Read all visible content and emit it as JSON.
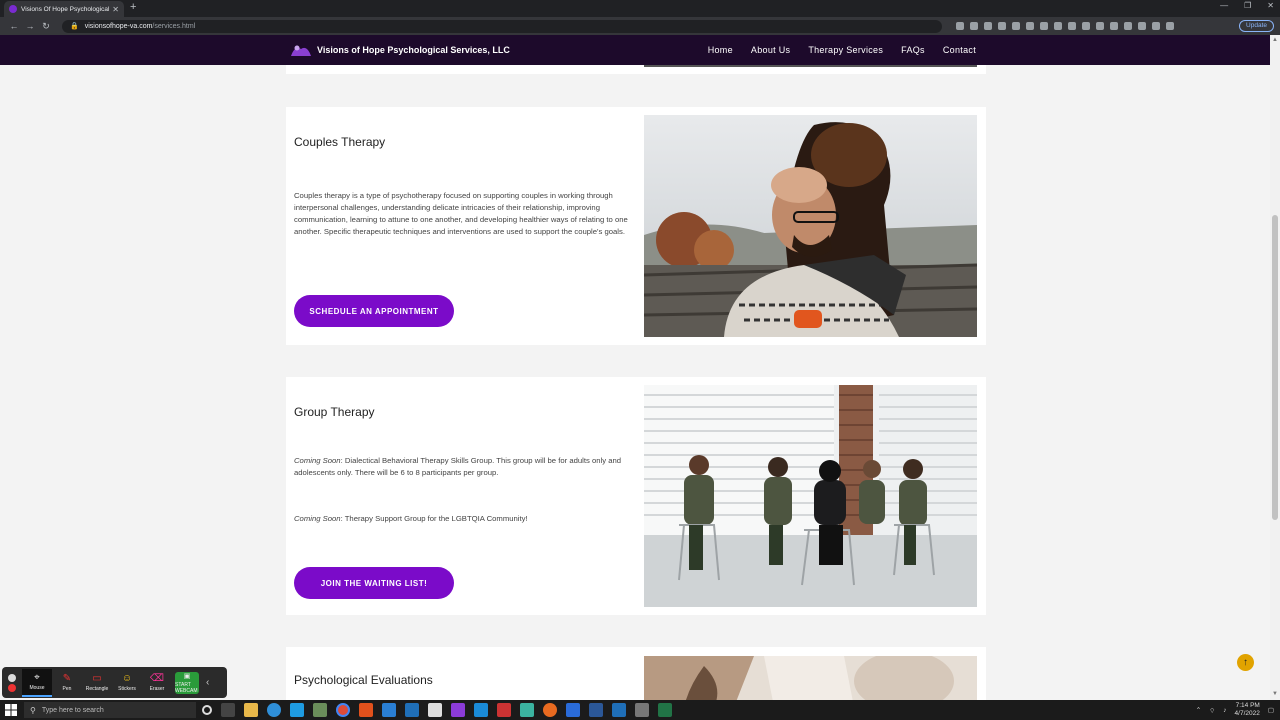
{
  "browser": {
    "tab_title": "Visions Of Hope Psychological S",
    "url_host": "visionsofhope-va.com",
    "url_path": "/services.html",
    "update_label": "Update"
  },
  "site": {
    "brand": "Visions of Hope Psychological Services, LLC",
    "nav": [
      "Home",
      "About Us",
      "Therapy Services",
      "FAQs",
      "Contact"
    ]
  },
  "sections": {
    "couples": {
      "title": "Couples Therapy",
      "body": "Couples therapy is a type of psychotherapy focused on supporting couples in working through interpersonal challenges, understanding delicate intricacies of their relationship, improving communication, learning to attune to one another, and developing healthier ways of relating to one another. Specific therapeutic techniques and interventions are used to support the couple's goals.",
      "button": "SCHEDULE AN APPOINTMENT"
    },
    "group": {
      "title": "Group Therapy",
      "item1_prefix": "Coming Soon",
      "item1_text": ": Dialectical Behavioral Therapy Skills Group. This group will be for adults only and adolescents only. There will be 6 to 8 participants per group.",
      "item2_prefix": "Coming Soon",
      "item2_text": ": Therapy Support Group for the LGBTQIA Community!",
      "button": "JOIN THE WAITING LIST!"
    },
    "evaluations": {
      "title": "Psychological Evaluations"
    }
  },
  "annotation_toolbar": {
    "tools": [
      "Mouse",
      "Pen",
      "Rectangle",
      "Stickers",
      "Eraser"
    ],
    "start": "START WEBCAM"
  },
  "taskbar": {
    "search_placeholder": "Type here to search",
    "time": "7:14 PM",
    "date": "4/7/2022"
  },
  "colors": {
    "nav_bg": "#1d0a2b",
    "accent": "#7b0bc9",
    "to_top": "#e1a300"
  }
}
